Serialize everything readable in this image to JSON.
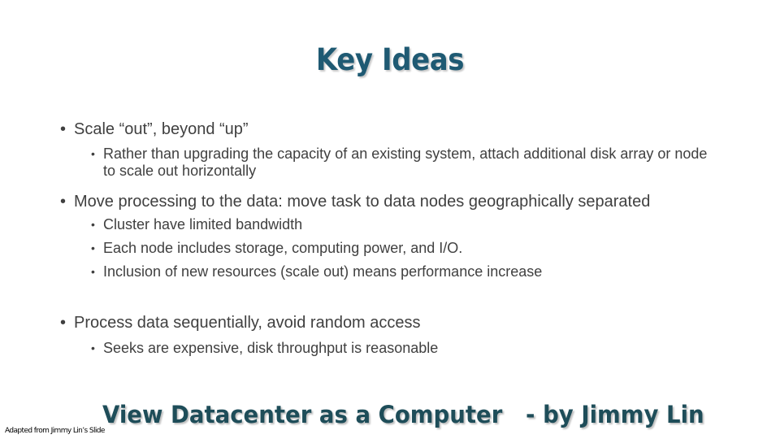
{
  "slide": {
    "title": "Key Ideas",
    "bullet_glyph": "•",
    "points": [
      {
        "text": "Scale “out”, beyond “up”",
        "sub": [
          "Rather than upgrading the capacity of an existing system, attach additional disk array or node to scale out horizontally"
        ]
      },
      {
        "text": "Move processing to the data: move task to data nodes geographically separated",
        "sub": [
          "Cluster have limited bandwidth",
          "Each node includes storage, computing power, and I/O.",
          "Inclusion of new resources (scale out) means performance increase"
        ]
      },
      {
        "text": "Process data sequentially, avoid random access",
        "sub": [
          "Seeks are expensive, disk throughput is reasonable"
        ]
      }
    ],
    "footer_title": "View Datacenter as a Computer   - by Jimmy Lin",
    "footer_credit": "Adapted from Jimmy Lin’s Slide"
  },
  "colors": {
    "title": "#1f5a73",
    "footer_title": "#1e4d59",
    "body_text": "#404040"
  }
}
